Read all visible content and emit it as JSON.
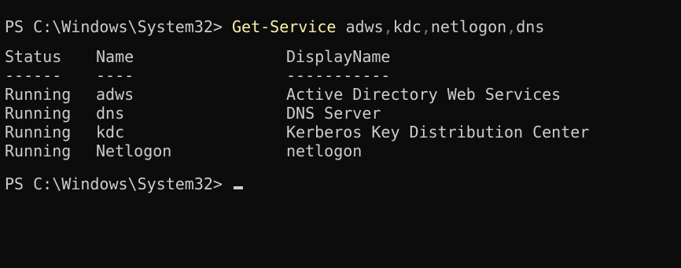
{
  "terminal": {
    "prompt1": "PS C:\\Windows\\System32> ",
    "command": {
      "name": "Get-Service",
      "args": [
        {
          "value": "adws",
          "sep": ","
        },
        {
          "value": "kdc",
          "sep": ","
        },
        {
          "value": "netlogon",
          "sep": ","
        },
        {
          "value": "dns",
          "sep": ""
        }
      ]
    },
    "table": {
      "headers": [
        "Status",
        "Name",
        "DisplayName"
      ],
      "underlines": [
        "------",
        "----",
        "-----------"
      ],
      "rows": [
        [
          "Running",
          "adws",
          "Active Directory Web Services"
        ],
        [
          "Running",
          "dns",
          "DNS Server"
        ],
        [
          "Running",
          "kdc",
          "Kerberos Key Distribution Center"
        ],
        [
          "Running",
          "Netlogon",
          "netlogon"
        ]
      ]
    },
    "prompt2": "PS C:\\Windows\\System32> "
  },
  "colors": {
    "background": "#0c0c0c",
    "text": "#cccccc",
    "command": "#f9f1a5",
    "separator": "#767676"
  }
}
